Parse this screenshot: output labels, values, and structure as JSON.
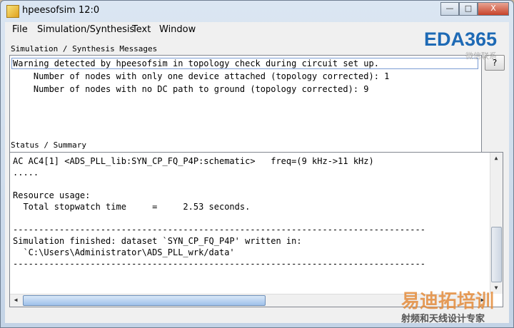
{
  "window": {
    "title": "hpeesofsim 12:0",
    "minimize": "—",
    "maximize": "□",
    "close": "X"
  },
  "menu": {
    "file": "File",
    "simulation": "Simulation/Synthesis",
    "text": "Text",
    "window": "Window"
  },
  "messages": {
    "label": "Simulation / Synthesis Messages",
    "lines": [
      "Warning detected by hpeesofsim in topology check during circuit set up.",
      "    Number of nodes with only one device attached (topology corrected): 1",
      "    Number of nodes with no DC path to ground (topology corrected): 9"
    ],
    "help_button": "?"
  },
  "status": {
    "label": "Status / Summary",
    "lines": [
      "AC AC4[1] <ADS_PLL_lib:SYN_CP_FQ_P4P:schematic>   freq=(9 kHz->11 kHz)",
      ".....",
      "",
      "Resource usage:",
      "  Total stopwatch time     =     2.53 seconds.",
      "",
      "--------------------------------------------------------------------------------",
      "Simulation finished: dataset `SYN_CP_FQ_P4P' written in:",
      "  `C:\\Users\\Administrator\\ADS_PLL_wrk/data'",
      "--------------------------------------------------------------------------------"
    ]
  },
  "scroll": {
    "up_arrow": "▲",
    "down_arrow": "▼",
    "left_arrow": "◀",
    "right_arrow": "▶"
  },
  "watermark": {
    "logo": "EDA365",
    "sub": "微信联系",
    "cn": "易迪拓培训",
    "cn_sub": "射频和天线设计专家"
  }
}
